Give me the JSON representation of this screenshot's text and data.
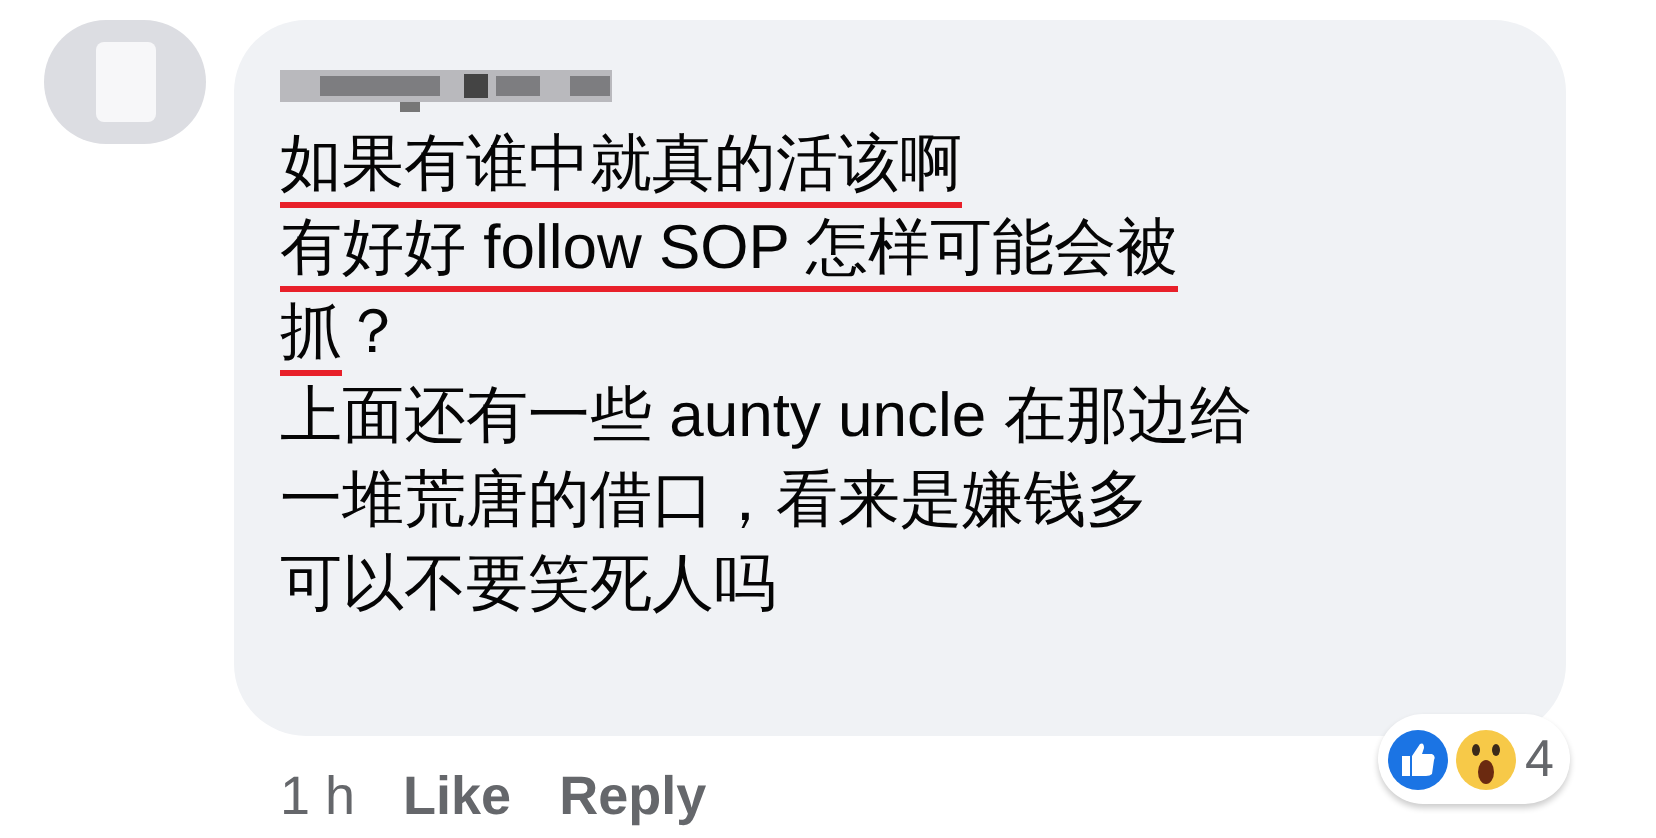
{
  "comment": {
    "lines": [
      {
        "segments": [
          {
            "text": "如果有谁中就真的活该啊",
            "underlined": true
          }
        ]
      },
      {
        "segments": [
          {
            "text": "有好好 follow SOP 怎样可能会被",
            "underlined": true
          }
        ]
      },
      {
        "segments": [
          {
            "text": "抓",
            "underlined": true
          },
          {
            "text": "？",
            "underlined": false
          }
        ]
      },
      {
        "segments": [
          {
            "text": "上面还有一些 aunty uncle 在那边给",
            "underlined": false
          }
        ]
      },
      {
        "segments": [
          {
            "text": "一堆荒唐的借口，看来是嫌钱多",
            "underlined": false
          }
        ]
      },
      {
        "segments": [
          {
            "text": "可以不要笑死人吗",
            "underlined": false
          }
        ]
      }
    ],
    "reactions": {
      "count": "4"
    },
    "time": "1 h",
    "actions": [
      "Like",
      "Reply"
    ]
  }
}
